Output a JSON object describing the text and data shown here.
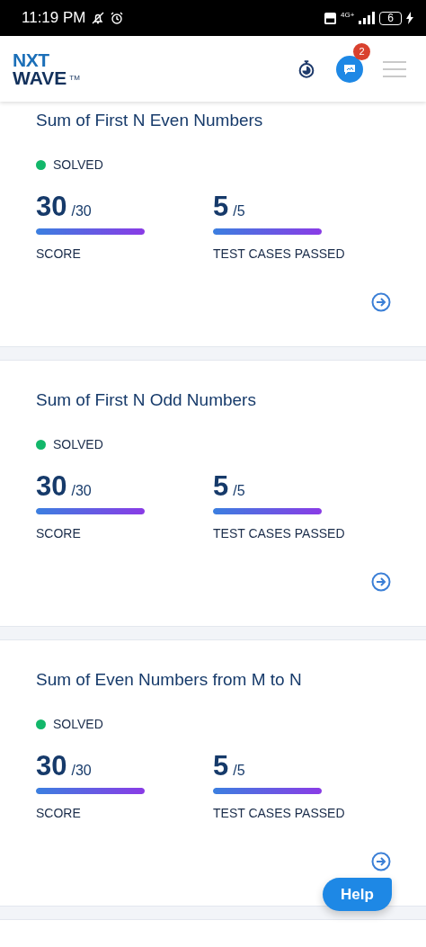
{
  "status_bar": {
    "time": "11:19 PM",
    "network": "4G+",
    "battery": "6"
  },
  "header": {
    "logo_top": "NXT",
    "logo_bottom": "WAVE",
    "logo_mark": "TM",
    "chat_badge": "2"
  },
  "problems": [
    {
      "title": "Sum of First N Even Numbers",
      "status": "SOLVED",
      "solved": true,
      "stats": [
        {
          "value": "30",
          "total": "/30",
          "level": 1,
          "label": "SCORE"
        },
        {
          "value": "5",
          "total": "/5",
          "level": 1,
          "label": "TEST CASES PASSED"
        }
      ]
    },
    {
      "title": "Sum of First N Odd Numbers",
      "status": "SOLVED",
      "solved": true,
      "stats": [
        {
          "value": "30",
          "total": "/30",
          "level": 1,
          "label": "SCORE"
        },
        {
          "value": "5",
          "total": "/5",
          "level": 1,
          "label": "TEST CASES PASSED"
        }
      ]
    },
    {
      "title": "Sum of Even Numbers from M to N",
      "status": "SOLVED",
      "solved": true,
      "stats": [
        {
          "value": "30",
          "total": "/30",
          "level": 1,
          "label": "SCORE"
        },
        {
          "value": "5",
          "total": "/5",
          "level": 1,
          "label": "TEST CASES PASSED"
        }
      ]
    }
  ],
  "help_button": "Help"
}
